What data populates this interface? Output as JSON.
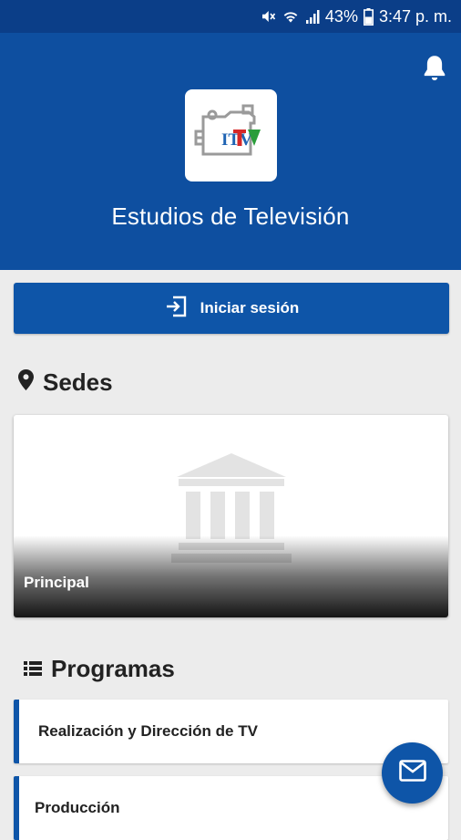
{
  "status_bar": {
    "battery": "43%",
    "time": "3:47 p. m.",
    "icons": [
      "mute-icon",
      "wifi-icon",
      "signal-icon",
      "battery-icon"
    ]
  },
  "header": {
    "title": "Estudios de Televisión",
    "logo_text": "ITV",
    "icons": [
      "bell-icon"
    ]
  },
  "login": {
    "label": "Iniciar sesión",
    "icon": "login-icon"
  },
  "sedes": {
    "heading": "Sedes",
    "icon": "location-pin-icon",
    "items": [
      {
        "label": "Principal",
        "icon": "building-icon"
      }
    ]
  },
  "programas": {
    "heading": "Programas",
    "icon": "list-icon",
    "items": [
      {
        "label": "Realización y Dirección de TV"
      },
      {
        "label": "Producción"
      }
    ]
  },
  "fab": {
    "icon": "mail-icon"
  },
  "colors": {
    "primary": "#0e4fa0",
    "status_bar": "#0b3e88",
    "accent": "#0e55a8",
    "background": "#ececec"
  }
}
